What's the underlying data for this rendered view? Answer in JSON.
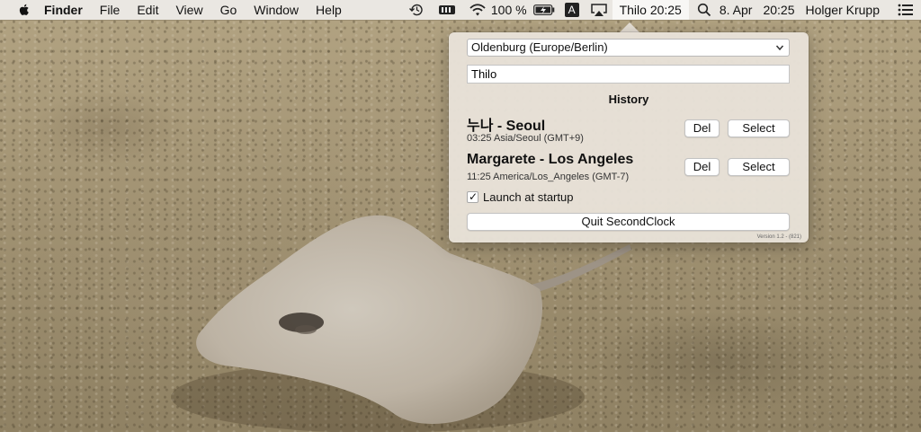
{
  "menubar": {
    "app_name": "Finder",
    "menus": [
      "File",
      "Edit",
      "View",
      "Go",
      "Window",
      "Help"
    ],
    "battery_percent": "100 %",
    "input_source": "A",
    "second_clock": "Thilo 20:25",
    "date": "8. Apr",
    "time": "20:25",
    "user": "Holger Krupp"
  },
  "popover": {
    "timezone_select": "Oldenburg (Europe/Berlin)",
    "name_field_value": "Thilo",
    "history_title": "History",
    "history": [
      {
        "name": "누나 - Seoul",
        "detail": "03:25 Asia/Seoul (GMT+9)",
        "del_label": "Del",
        "select_label": "Select"
      },
      {
        "name": "Margarete - Los Angeles",
        "detail": "11:25 America/Los_Angeles (GMT-7)",
        "del_label": "Del",
        "select_label": "Select"
      }
    ],
    "launch_at_startup_label": "Launch at startup",
    "launch_at_startup_checked": true,
    "quit_label": "Quit SecondClock",
    "version": "Version 1.2 - (821)"
  }
}
